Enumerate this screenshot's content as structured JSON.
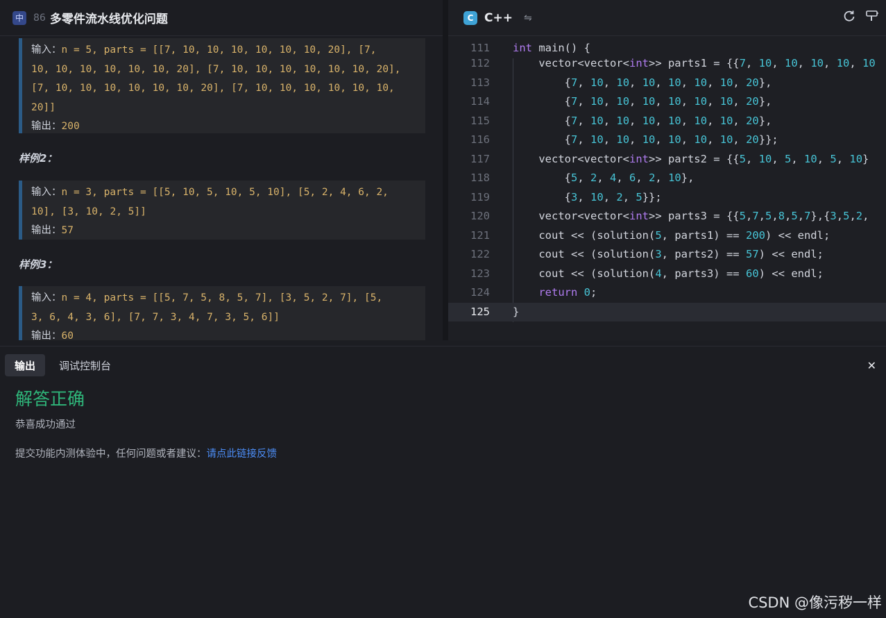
{
  "problem": {
    "badge": "中",
    "number": "86",
    "title": "多零件流水线优化问题"
  },
  "examples": {
    "ex1": {
      "input_label": "输入：",
      "input_l1": "n = 5, parts = [[7, 10, 10, 10, 10, 10, 10, 20], [7,",
      "input_l2": "10, 10, 10, 10, 10, 10, 20], [7, 10, 10, 10, 10, 10, 10, 20],",
      "input_l3": "[7, 10, 10, 10, 10, 10, 10, 20], [7, 10, 10, 10, 10, 10, 10,",
      "input_l4": "20]]",
      "output_label": "输出：",
      "output": "200"
    },
    "ex2": {
      "heading": "样例2：",
      "input_label": "输入：",
      "input_l1": "n = 3, parts = [[5, 10, 5, 10, 5, 10], [5, 2, 4, 6, 2,",
      "input_l2": "10], [3, 10, 2, 5]]",
      "output_label": "输出：",
      "output": "57"
    },
    "ex3": {
      "heading": "样例3：",
      "input_label": "输入：",
      "input_l1": "n = 4, parts = [[5, 7, 5, 8, 5, 7], [3, 5, 2, 7], [5,",
      "input_l2": "3, 6, 4, 3, 6], [7, 7, 3, 4, 7, 3, 5, 6]]",
      "output_label": "输出：",
      "output": "60"
    }
  },
  "editor": {
    "language": "C++",
    "swap_icon": "swap-icon",
    "reset_icon": "refresh-icon",
    "format_icon": "format-icon",
    "lines": [
      {
        "n": "111"
      },
      {
        "n": "112"
      },
      {
        "n": "113"
      },
      {
        "n": "114"
      },
      {
        "n": "115"
      },
      {
        "n": "116"
      },
      {
        "n": "117"
      },
      {
        "n": "118"
      },
      {
        "n": "119"
      },
      {
        "n": "120"
      },
      {
        "n": "121"
      },
      {
        "n": "122"
      },
      {
        "n": "123"
      },
      {
        "n": "124"
      },
      {
        "n": "125"
      }
    ]
  },
  "output_panel": {
    "tab_output": "输出",
    "tab_console": "调试控制台",
    "result": "解答正确",
    "subtitle": "恭喜成功通过",
    "feedback_text": "提交功能内测体验中，任何问题或者建议：",
    "feedback_link": "请点此链接反馈"
  },
  "watermark": "CSDN @像污秽一样",
  "colors": {
    "accent_green": "#2fb67a",
    "link_blue": "#4c8df6",
    "keyword": "#b07cf0",
    "number": "#47c4d6",
    "string_yellow": "#d9b36a"
  }
}
